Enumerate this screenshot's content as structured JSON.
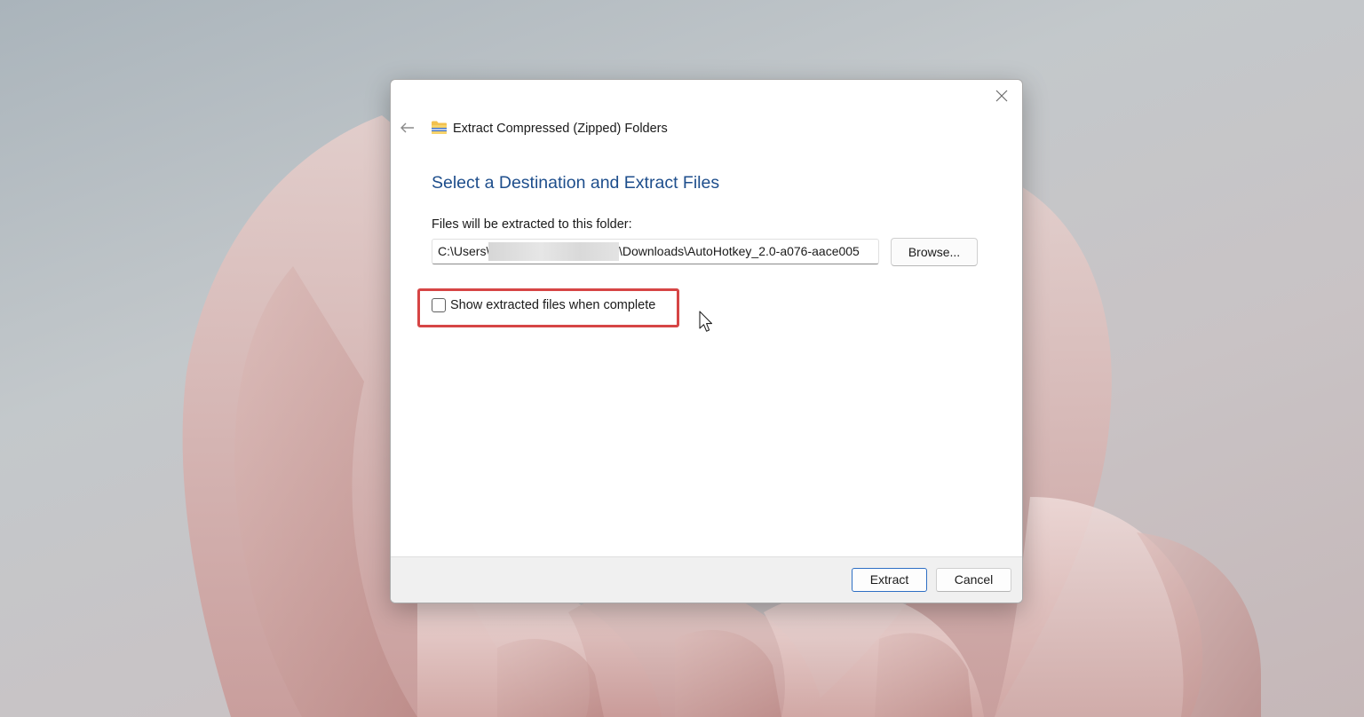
{
  "window": {
    "title": "Extract Compressed (Zipped) Folders",
    "title_icon": "zip-folder-icon",
    "close_icon": "close-icon",
    "back_icon": "arrow-left-icon"
  },
  "main": {
    "heading": "Select a Destination and Extract Files",
    "destination_label": "Files will be extracted to this folder:",
    "path_prefix": "C:\\Users\\",
    "path_suffix": "\\Downloads\\AutoHotkey_2.0-a076-aace005",
    "browse_label": "Browse...",
    "show_files_label": "Show extracted files when complete",
    "show_files_checked": false
  },
  "footer": {
    "extract_label": "Extract",
    "cancel_label": "Cancel"
  },
  "colors": {
    "heading": "#1e4e8c",
    "highlight": "#d64545",
    "default_button_border": "#2e6fc4"
  }
}
